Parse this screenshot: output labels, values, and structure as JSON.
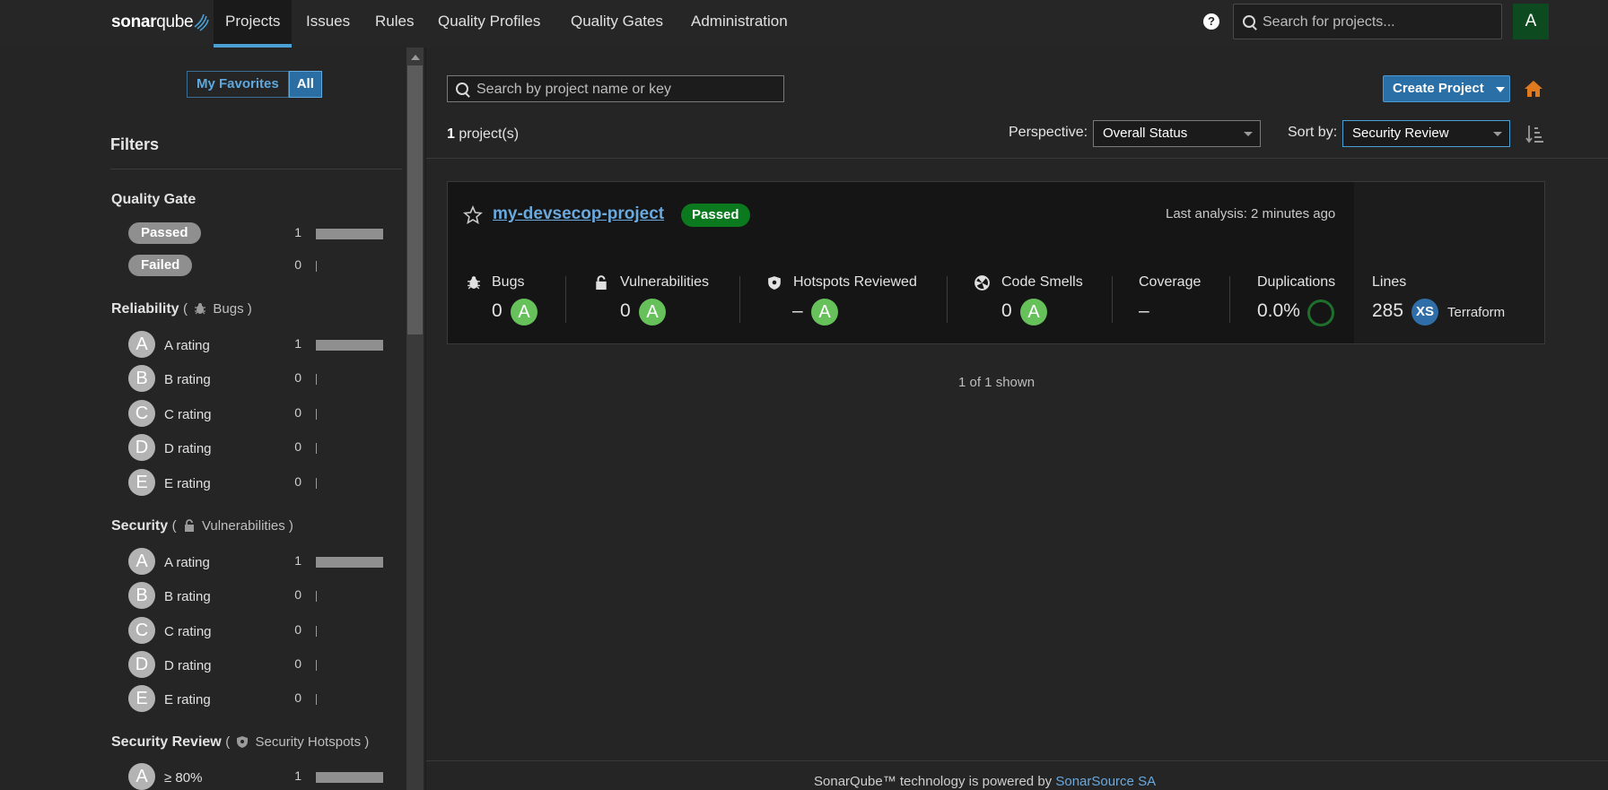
{
  "nav": {
    "logo_bold": "sonar",
    "logo_light": "qube",
    "items": [
      "Projects",
      "Issues",
      "Rules",
      "Quality Profiles",
      "Quality Gates",
      "Administration"
    ],
    "active_item": "Projects",
    "help_glyph": "?",
    "search_placeholder": "Search for projects...",
    "avatar_letter": "A"
  },
  "sidebar": {
    "toggle": {
      "favorites": "My Favorites",
      "all": "All",
      "selected": "All"
    },
    "title": "Filters",
    "quality_gate": {
      "title": "Quality Gate",
      "rows": [
        {
          "label": "Passed",
          "count": "1",
          "bar_fraction": 1
        },
        {
          "label": "Failed",
          "count": "0",
          "bar_fraction": 0
        }
      ]
    },
    "reliability": {
      "title": "Reliability",
      "sub": "Bugs",
      "rows": [
        {
          "letter": "A",
          "label": "A rating",
          "count": "1",
          "bar_fraction": 1
        },
        {
          "letter": "B",
          "label": "B rating",
          "count": "0",
          "bar_fraction": 0
        },
        {
          "letter": "C",
          "label": "C rating",
          "count": "0",
          "bar_fraction": 0
        },
        {
          "letter": "D",
          "label": "D rating",
          "count": "0",
          "bar_fraction": 0
        },
        {
          "letter": "E",
          "label": "E rating",
          "count": "0",
          "bar_fraction": 0
        }
      ]
    },
    "security": {
      "title": "Security",
      "sub": "Vulnerabilities",
      "rows": [
        {
          "letter": "A",
          "label": "A rating",
          "count": "1",
          "bar_fraction": 1
        },
        {
          "letter": "B",
          "label": "B rating",
          "count": "0",
          "bar_fraction": 0
        },
        {
          "letter": "C",
          "label": "C rating",
          "count": "0",
          "bar_fraction": 0
        },
        {
          "letter": "D",
          "label": "D rating",
          "count": "0",
          "bar_fraction": 0
        },
        {
          "letter": "E",
          "label": "E rating",
          "count": "0",
          "bar_fraction": 0
        }
      ]
    },
    "security_review": {
      "title": "Security Review",
      "sub": "Security Hotspots",
      "rows": [
        {
          "letter": "A",
          "label": "≥ 80%",
          "count": "1",
          "bar_fraction": 1
        }
      ]
    }
  },
  "main": {
    "search_placeholder": "Search by project name or key",
    "create_button": "Create Project",
    "project_count": "1",
    "project_count_suffix": "project(s)",
    "perspective_label": "Perspective:",
    "perspective_value": "Overall Status",
    "sort_label": "Sort by:",
    "sort_value": "Security Review",
    "shown_text": "1 of 1 shown"
  },
  "project": {
    "name": "my-devsecop-project",
    "quality_gate": "Passed",
    "last_analysis": "Last analysis: 2 minutes ago",
    "metrics": {
      "bugs": {
        "label": "Bugs",
        "value": "0",
        "rating": "A"
      },
      "vulnerabilities": {
        "label": "Vulnerabilities",
        "value": "0",
        "rating": "A"
      },
      "hotspots": {
        "label": "Hotspots Reviewed",
        "value": "–",
        "rating": "A"
      },
      "code_smells": {
        "label": "Code Smells",
        "value": "0",
        "rating": "A"
      },
      "coverage": {
        "label": "Coverage",
        "value": "–"
      },
      "duplications": {
        "label": "Duplications",
        "value": "0.0%"
      },
      "lines": {
        "label": "Lines",
        "value": "285",
        "size": "XS",
        "language": "Terraform"
      }
    }
  },
  "footer": {
    "text": "SonarQube™ technology is powered by",
    "link": "SonarSource SA"
  },
  "colors": {
    "background": "#252525",
    "accent": "#4b9fd5",
    "rating_a": "#66c15a",
    "passed": "#0b7a1e",
    "create_button": "#2a6fa5",
    "home_icon": "#e07a1f"
  }
}
